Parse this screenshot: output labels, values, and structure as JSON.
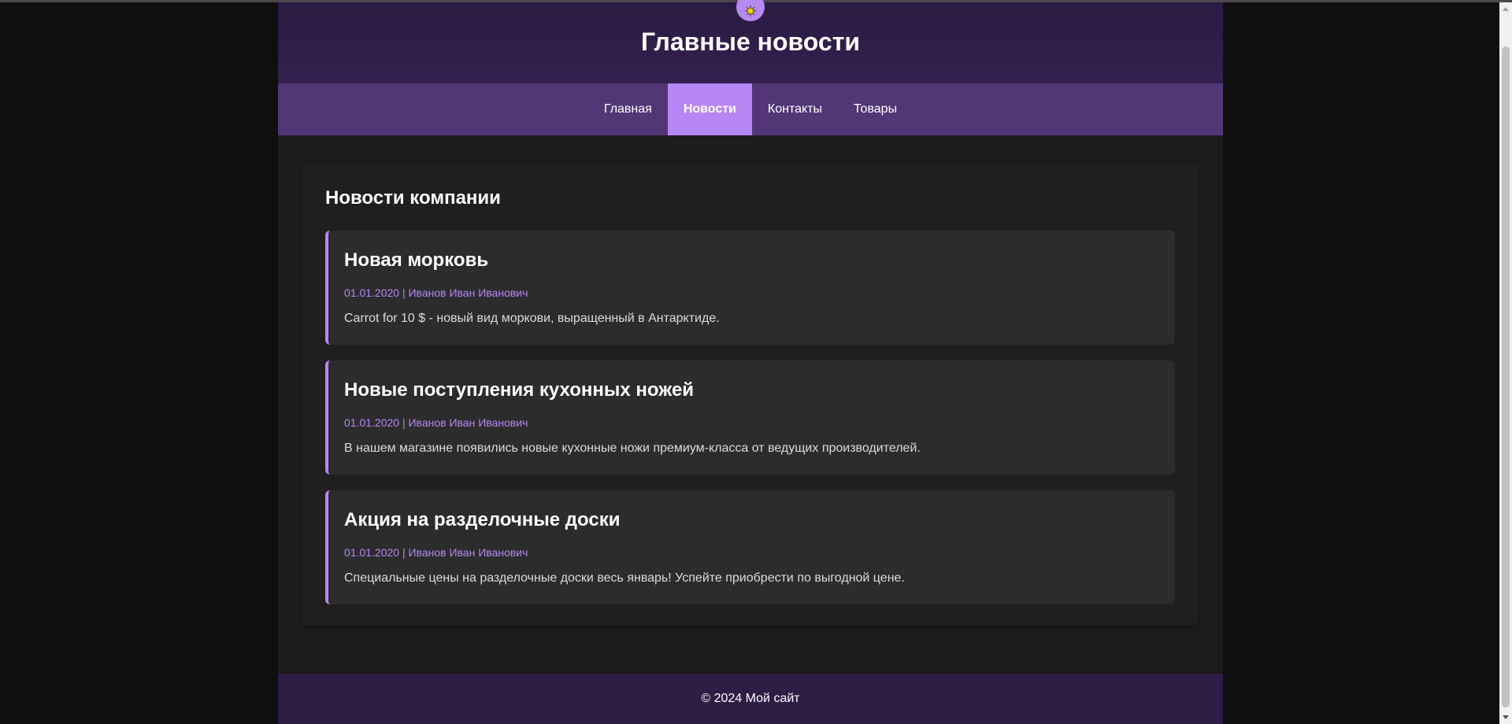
{
  "header": {
    "title": "Главные новости",
    "logo_icon": "sun-icon"
  },
  "nav": {
    "items": [
      {
        "label": "Главная",
        "active": false
      },
      {
        "label": "Новости",
        "active": true
      },
      {
        "label": "Контакты",
        "active": false
      },
      {
        "label": "Товары",
        "active": false
      }
    ]
  },
  "main": {
    "section_title": "Новости компании",
    "articles": [
      {
        "title": "Новая морковь",
        "date": "01.01.2020",
        "author": "Иванов Иван Иванович",
        "meta": "01.01.2020 | Иванов Иван Иванович",
        "text": "Carrot for 10 $ - новый вид моркови, выращенный в Антарктиде."
      },
      {
        "title": "Новые поступления кухонных ножей",
        "date": "01.01.2020",
        "author": "Иванов Иван Иванович",
        "meta": "01.01.2020 | Иванов Иван Иванович",
        "text": "В нашем магазине появились новые кухонные ножи премиум-класса от ведущих производителей."
      },
      {
        "title": "Акция на разделочные доски",
        "date": "01.01.2020",
        "author": "Иванов Иван Иванович",
        "meta": "01.01.2020 | Иванов Иван Иванович",
        "text": "Специальные цены на разделочные доски весь январь! Успейте приобрести по выгодной цене."
      }
    ]
  },
  "footer": {
    "text": "© 2024 Мой сайт"
  },
  "colors": {
    "accent": "#b786f5",
    "header_bg": "#2e1d45",
    "nav_bg": "#533676",
    "page_bg": "#1c1c1c",
    "card_bg": "#2c2c2c"
  }
}
